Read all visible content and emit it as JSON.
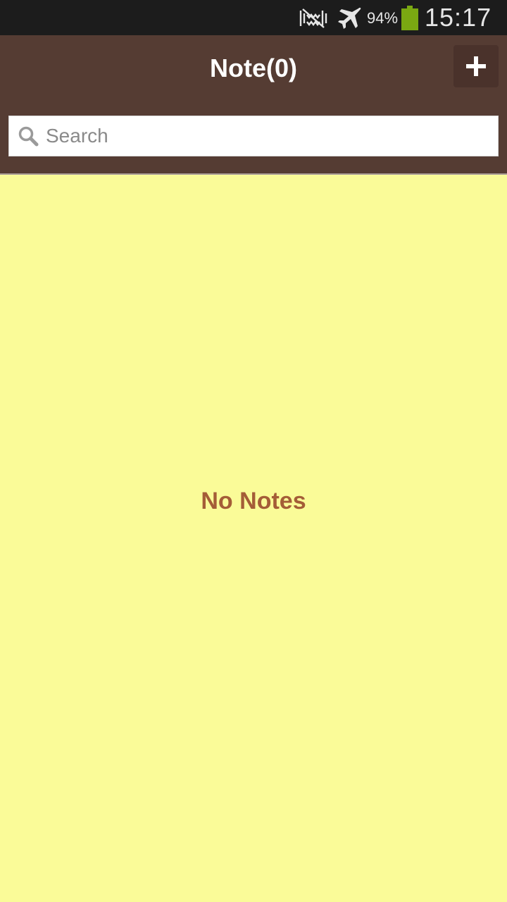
{
  "status_bar": {
    "battery_percent": "94%",
    "battery_level": 0.94,
    "time": "15:17",
    "icons": [
      "no-signal-icon",
      "airplane-mode-icon",
      "battery-icon"
    ],
    "battery_color": "#7aa812"
  },
  "header": {
    "title": "Note(0)",
    "add_icon": "plus-icon",
    "background_color": "#553c33"
  },
  "search": {
    "placeholder": "Search",
    "value": "",
    "icon": "search-icon"
  },
  "main": {
    "empty_message": "No Notes",
    "background_color": "#fafb98",
    "message_color": "#a45d37"
  }
}
